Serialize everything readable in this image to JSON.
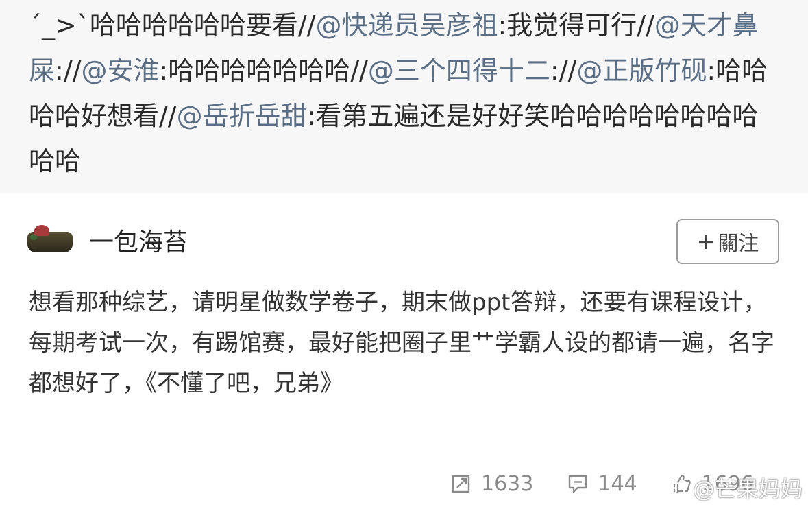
{
  "repost": {
    "segments": [
      {
        "text": "´_>`哈哈哈哈哈哈要看//",
        "type": "text"
      },
      {
        "text": "@快递员吴彦祖",
        "type": "mention"
      },
      {
        "text": ":我觉得可行//",
        "type": "text"
      },
      {
        "text": "@天才鼻屎",
        "type": "mention"
      },
      {
        "text": "://",
        "type": "text"
      },
      {
        "text": "@安淮",
        "type": "mention"
      },
      {
        "text": ":哈哈哈哈哈哈哈//",
        "type": "text"
      },
      {
        "text": "@三个四得十二",
        "type": "mention"
      },
      {
        "text": "://",
        "type": "text"
      },
      {
        "text": "@正版竹砚",
        "type": "mention"
      },
      {
        "text": ":哈哈哈哈好想看//",
        "type": "text"
      },
      {
        "text": "@岳折岳甜",
        "type": "mention"
      },
      {
        "text": ":看第五遍还是好好笑哈哈哈哈哈哈哈哈哈哈",
        "type": "text"
      }
    ]
  },
  "post": {
    "author": "一包海苔",
    "follow_label": "關注",
    "follow_plus": "+",
    "body": "想看那种综艺，请明星做数学卷子，期末做ppt答辩，还要有课程设计，每期考试一次，有踢馆赛，最好能把圈子里艹学霸人设的都请一遍，名字都想好了，《不懂了吧，兄弟》",
    "reposts": "1633",
    "comments": "144",
    "likes": "1696"
  },
  "watermark": {
    "text": "@芒果妈妈"
  },
  "colors": {
    "mention": "#5a6f86",
    "repost_bg": "#f7f7f7",
    "action_gray": "#8b8b8b"
  }
}
